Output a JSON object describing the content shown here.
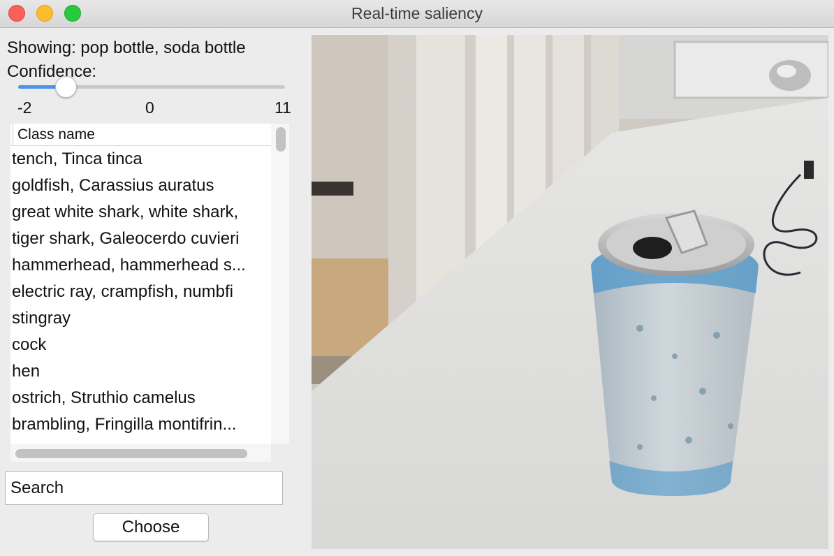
{
  "window": {
    "title": "Real-time saliency"
  },
  "showing": "Showing: pop bottle, soda bottle",
  "confidence": {
    "label": "Confidence:",
    "ticks": [
      "-2",
      "0",
      "11"
    ],
    "min": -2,
    "max": 11,
    "value": 0.4
  },
  "list": {
    "header": "Class name",
    "items": [
      "tench, Tinca tinca",
      "goldfish, Carassius auratus",
      "great white shark, white shark,",
      "tiger shark, Galeocerdo cuvieri",
      "hammerhead, hammerhead s...",
      "electric ray, crampfish, numbfi",
      "stingray",
      "cock",
      "hen",
      "ostrich, Struthio camelus",
      "brambling, Fringilla montifrin..."
    ]
  },
  "search": {
    "placeholder": "Search"
  },
  "buttons": {
    "choose": "Choose"
  },
  "colors": {
    "accent": "#4f93e8",
    "close": "#fc5f57",
    "minimize": "#fdbc2e",
    "maximize": "#28c840"
  }
}
